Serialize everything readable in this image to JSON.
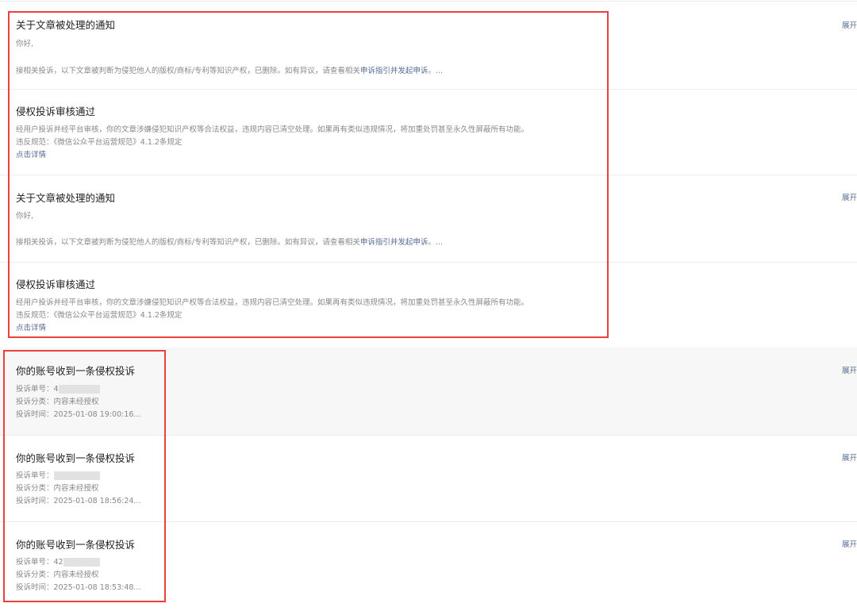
{
  "expand_label": "展开",
  "notices": [
    {
      "title": "关于文章被处理的通知",
      "greeting": "你好,",
      "body_prefix": "接相关投诉，以下文章被判断为侵犯他人的版权/商标/专利等知识产权，已删除。如有异议，请查看相关",
      "body_link": "申诉指引并发起申诉",
      "body_suffix": "。..."
    },
    {
      "title": "侵权投诉审核通过",
      "body": "经用户投诉并经平台审核，你的文章涉嫌侵犯知识产权等合法权益，违规内容已清空处理。如果再有类似违规情况，将加重处罚甚至永久性屏蔽所有功能。",
      "rule": "违反规范：《微信公众平台运营规范》4.1.2条规定",
      "link": "点击详情"
    },
    {
      "title": "关于文章被处理的通知",
      "greeting": "你好,",
      "body_prefix": "接相关投诉，以下文章被判断为侵犯他人的版权/商标/专利等知识产权，已删除。如有异议，请查看相关",
      "body_link": "申诉指引并发起申诉",
      "body_suffix": "。..."
    },
    {
      "title": "侵权投诉审核通过",
      "body": "经用户投诉并经平台审核，你的文章涉嫌侵犯知识产权等合法权益，违规内容已清空处理。如果再有类似违规情况，将加重处罚甚至永久性屏蔽所有功能。",
      "rule": "违反规范：《微信公众平台运营规范》4.1.2条规定",
      "link": "点击详情"
    }
  ],
  "complaints": [
    {
      "title": "你的账号收到一条侵权投诉",
      "number_label": "投诉单号：",
      "number_value": "4",
      "category_label": "投诉分类：",
      "category_value": "内容未经授权",
      "time_label": "投诉时间：",
      "time_value": "2025-01-08 19:00:16..."
    },
    {
      "title": "你的账号收到一条侵权投诉",
      "number_label": "投诉单号：",
      "number_value": "",
      "category_label": "投诉分类：",
      "category_value": "内容未经授权",
      "time_label": "投诉时间：",
      "time_value": "2025-01-08 18:56:24..."
    },
    {
      "title": "你的账号收到一条侵权投诉",
      "number_label": "投诉单号：",
      "number_value": "42",
      "category_label": "投诉分类：",
      "category_value": "内容未经授权",
      "time_label": "投诉时间：",
      "time_value": "2025-01-08 18:53:48..."
    }
  ]
}
